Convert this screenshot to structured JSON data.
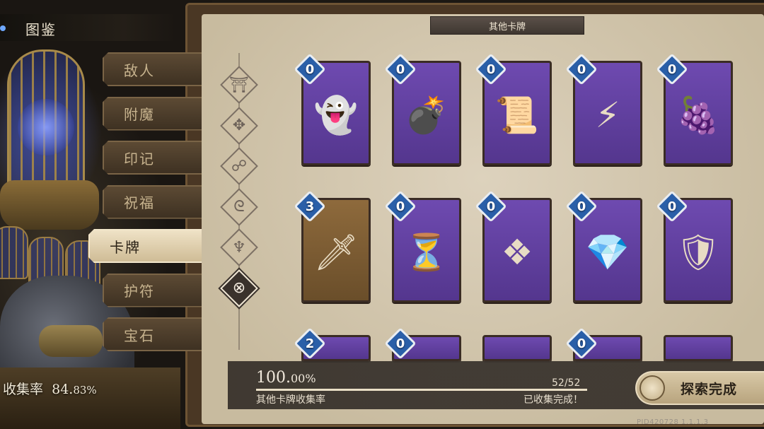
{
  "header": {
    "title": "图鉴"
  },
  "categories": [
    {
      "label": "敌人",
      "active": false
    },
    {
      "label": "附魔",
      "active": false
    },
    {
      "label": "印记",
      "active": false
    },
    {
      "label": "祝福",
      "active": false
    },
    {
      "label": "卡牌",
      "active": true
    },
    {
      "label": "护符",
      "active": false
    },
    {
      "label": "宝石",
      "active": false
    }
  ],
  "collection": {
    "rate_main": "84.",
    "rate_decimal": "83%",
    "label": "收集率"
  },
  "panel": {
    "title": "其他卡牌"
  },
  "subcategories": [
    {
      "icon": "pillar-emblem-icon",
      "glyph": "⛩",
      "active": false
    },
    {
      "icon": "knot-emblem-icon",
      "glyph": "✥",
      "active": false
    },
    {
      "icon": "rune-emblem-icon",
      "glyph": "☍",
      "active": false
    },
    {
      "icon": "swirl-emblem-icon",
      "glyph": "ᘓ",
      "active": false
    },
    {
      "icon": "mask-emblem-icon",
      "glyph": "♆",
      "active": false
    },
    {
      "icon": "other-emblem-icon",
      "glyph": "⊗",
      "active": true
    }
  ],
  "cards": [
    {
      "cost": "0",
      "art": "ghost-cauldron",
      "glyph": "👻",
      "frame": "purple"
    },
    {
      "cost": "0",
      "art": "red-bomb",
      "glyph": "💣",
      "frame": "purple"
    },
    {
      "cost": "0",
      "art": "kunai-scroll",
      "glyph": "📜",
      "frame": "purple"
    },
    {
      "cost": "0",
      "art": "lightning-burst",
      "glyph": "⚡",
      "frame": "purple"
    },
    {
      "cost": "0",
      "art": "devil-fruit",
      "glyph": "🍇",
      "frame": "purple"
    },
    {
      "cost": "3",
      "art": "cursed-sword",
      "glyph": "🗡",
      "frame": "brown"
    },
    {
      "cost": "0",
      "art": "hourglass-vial",
      "glyph": "⏳",
      "frame": "purple"
    },
    {
      "cost": "0",
      "art": "crystal-pendant",
      "glyph": "❖",
      "frame": "purple"
    },
    {
      "cost": "0",
      "art": "amethyst-cluster",
      "glyph": "💎",
      "frame": "purple"
    },
    {
      "cost": "0",
      "art": "bronze-shield-amulet",
      "glyph": "🛡",
      "frame": "purple"
    },
    {
      "cost": "2",
      "art": "partial-card",
      "glyph": "",
      "frame": "purple"
    },
    {
      "cost": "0",
      "art": "partial-card",
      "glyph": "",
      "frame": "purple"
    },
    {
      "cost": "",
      "art": "partial-card",
      "glyph": "",
      "frame": "purple"
    },
    {
      "cost": "0",
      "art": "partial-card",
      "glyph": "",
      "frame": "purple"
    },
    {
      "cost": "",
      "art": "partial-card",
      "glyph": "",
      "frame": "purple"
    }
  ],
  "progress": {
    "percent_main": "100.",
    "percent_decimal": "00%",
    "fraction": 1.0,
    "count": "52/52",
    "label": "其他卡牌收集率",
    "status": "已收集完成！"
  },
  "actions": {
    "explore_label": "探索完成"
  },
  "footer": {
    "pid": "PID420728  1.1.1.3"
  },
  "colors": {
    "card_purple": "#6e4ab0",
    "card_brown": "#8e6a3c",
    "badge_blue": "#2a5fa8",
    "panel_bg": "#ddd2bd"
  }
}
